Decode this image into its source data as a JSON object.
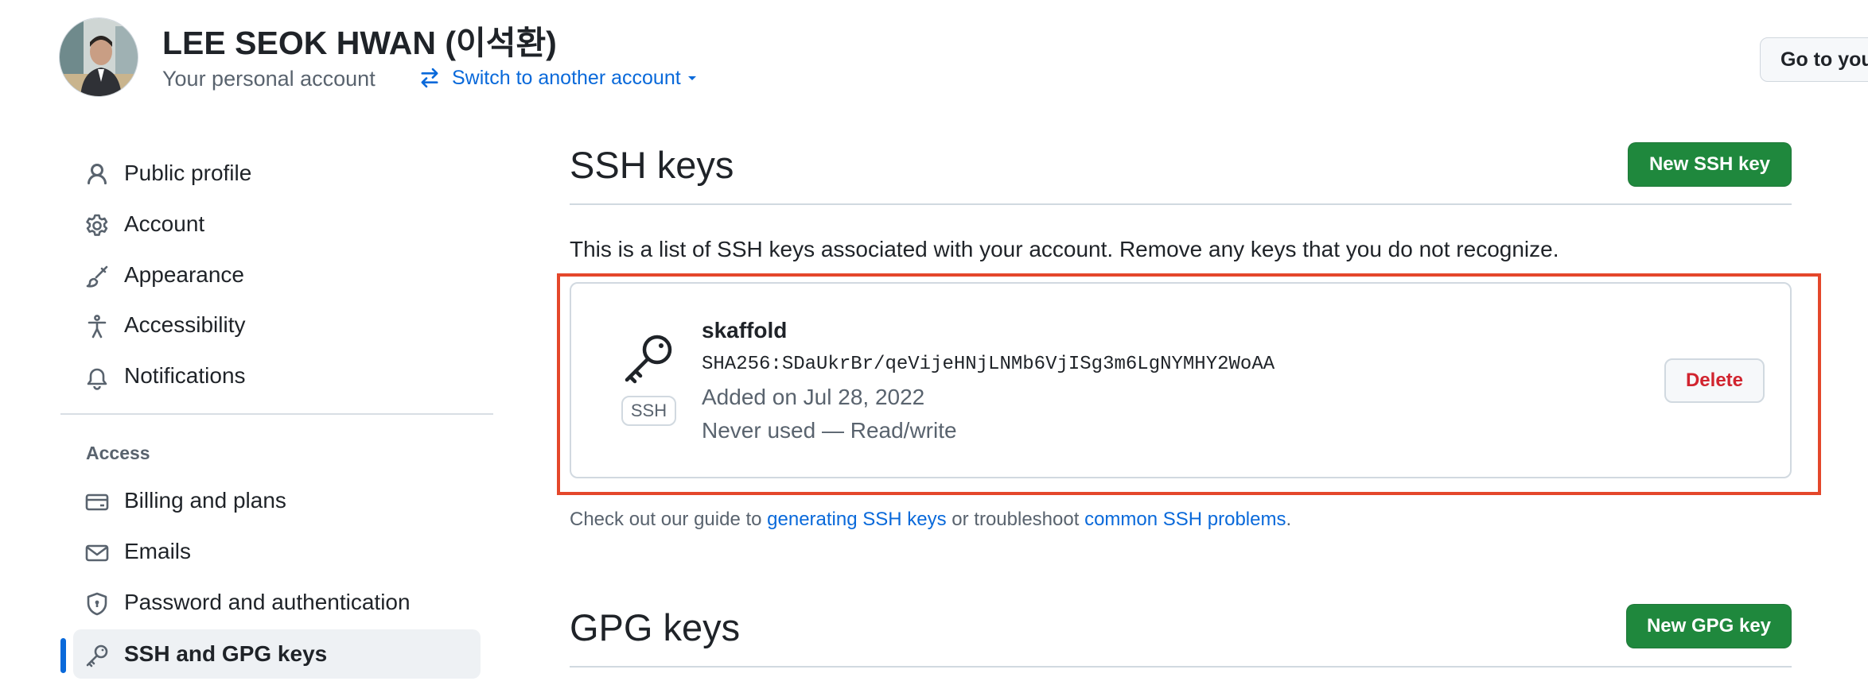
{
  "header": {
    "user_name": "LEE SEOK HWAN (이석환)",
    "account_type": "Your personal account",
    "switch_account": "Switch to another account",
    "go_to_button": "Go to your personal profile"
  },
  "sidebar": {
    "items": [
      {
        "label": "Public profile",
        "icon": "person-icon"
      },
      {
        "label": "Account",
        "icon": "gear-icon"
      },
      {
        "label": "Appearance",
        "icon": "paintbrush-icon"
      },
      {
        "label": "Accessibility",
        "icon": "accessibility-icon"
      },
      {
        "label": "Notifications",
        "icon": "bell-icon"
      }
    ],
    "access_heading": "Access",
    "access_items": [
      {
        "label": "Billing and plans",
        "icon": "credit-card-icon"
      },
      {
        "label": "Emails",
        "icon": "mail-icon"
      },
      {
        "label": "Password and authentication",
        "icon": "shield-lock-icon"
      },
      {
        "label": "SSH and GPG keys",
        "icon": "key-icon",
        "active": true
      }
    ]
  },
  "ssh": {
    "title": "SSH keys",
    "new_button": "New SSH key",
    "intro": "This is a list of SSH keys associated with your account. Remove any keys that you do not recognize.",
    "keys": [
      {
        "type_label": "SSH",
        "title": "skaffold",
        "fingerprint": "SHA256:SDaUkrBr/qeVijeHNjLNMb6VjISg3m6LgNYMHY2WoAA",
        "added": "Added on Jul 28, 2022",
        "usage": "Never used — Read/write",
        "delete_label": "Delete"
      }
    ],
    "help": {
      "prefix": "Check out our guide to ",
      "link1": "generating SSH keys",
      "middle": " or troubleshoot ",
      "link2": "common SSH problems",
      "suffix": "."
    }
  },
  "gpg": {
    "title": "GPG keys",
    "new_button": "New GPG key"
  },
  "colors": {
    "accent": "#0969da",
    "primary_button": "#1f883d",
    "danger": "#d1242f",
    "highlight_box": "#e4472b"
  }
}
